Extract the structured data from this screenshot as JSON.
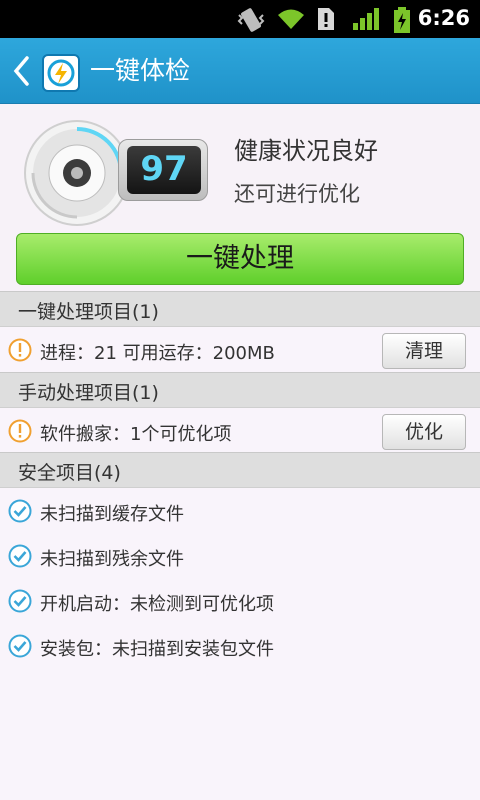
{
  "statusbar": {
    "time": "6:26",
    "icons": [
      "vibrate-icon",
      "wifi-icon",
      "notification-icon",
      "signal-icon",
      "battery-icon"
    ]
  },
  "titlebar": {
    "title": "一键体检",
    "back_icon": "chevron-left-icon",
    "app_icon": "lightning-icon"
  },
  "score": {
    "value": "97",
    "status_title": "健康状况良好",
    "status_sub": "还可进行优化"
  },
  "main_button": "一键处理",
  "sections": [
    {
      "title": "一键处理项目(1)",
      "items": [
        {
          "label": "进程：21  可用运存：200MB",
          "icon": "info-icon",
          "button": "清理"
        }
      ]
    },
    {
      "title": "手动处理项目(1)",
      "items": [
        {
          "label": "软件搬家：1个可优化项",
          "icon": "info-icon",
          "button": "优化"
        }
      ]
    },
    {
      "title": "安全项目(4)",
      "items": [
        {
          "label": "未扫描到缓存文件",
          "icon": "check-icon"
        },
        {
          "label": "未扫描到残余文件",
          "icon": "check-icon"
        },
        {
          "label": "开机启动：未检测到可优化项",
          "icon": "check-icon"
        },
        {
          "label": "安装包：未扫描到安装包文件",
          "icon": "check-icon"
        }
      ]
    }
  ],
  "colors": {
    "titlebar": "#1f92c9",
    "accent_green": "#5fcf2b",
    "score_text": "#5fd6f5",
    "info_orange": "#f0a030",
    "check_blue": "#3aa6d8"
  }
}
